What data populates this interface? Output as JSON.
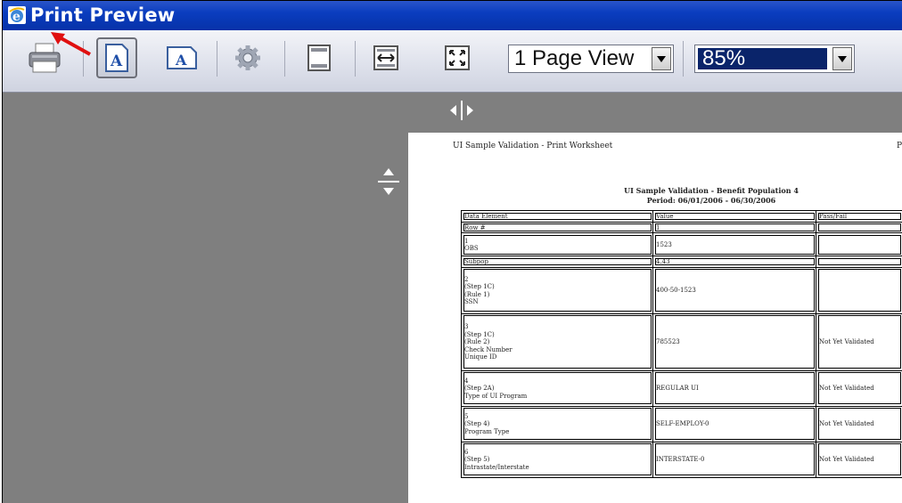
{
  "window": {
    "title": "Print Preview"
  },
  "toolbar": {
    "print_icon": "printer-icon",
    "page_view": {
      "selected": "1 Page View"
    },
    "zoom": {
      "selected": "85%"
    }
  },
  "page": {
    "header_left": "UI Sample Validation - Print Worksheet",
    "header_right": "P",
    "report_title": "UI Sample Validation - Benefit Population 4",
    "report_period": "Period: 06/01/2006 - 06/30/2006",
    "columns": [
      "Data Element",
      "Value",
      "Pass/Fail"
    ],
    "rows": [
      {
        "element": [
          "Row #"
        ],
        "value": "1",
        "status": ""
      },
      {
        "element": [
          "1",
          "OBS"
        ],
        "value": "1523",
        "status": ""
      },
      {
        "element": [
          "Subpop"
        ],
        "value": "4.43",
        "status": ""
      },
      {
        "element": [
          "2",
          "(Step 1C)",
          "(Rule 1)",
          "SSN"
        ],
        "value": "400-50-1523",
        "status": ""
      },
      {
        "element": [
          "3",
          "(Step 1C)",
          "(Rule 2)",
          "Check Number",
          "Unique ID"
        ],
        "value": "785523",
        "status": "Not Yet Validated"
      },
      {
        "element": [
          "4",
          "(Step 2A)",
          "Type of UI Program"
        ],
        "value": "REGULAR UI",
        "status": "Not Yet Validated"
      },
      {
        "element": [
          "5",
          "(Step 4)",
          "Program Type"
        ],
        "value": "SELF-EMPLOY-0",
        "status": "Not Yet Validated"
      },
      {
        "element": [
          "6",
          "(Step 5)",
          "Intrastate/Interstate"
        ],
        "value": "INTERSTATE-0",
        "status": "Not Yet Validated"
      }
    ]
  },
  "colors": {
    "titlebar": "#0a3dbf",
    "workspace": "#7f7f7f",
    "annotation_arrow": "#e01010"
  }
}
